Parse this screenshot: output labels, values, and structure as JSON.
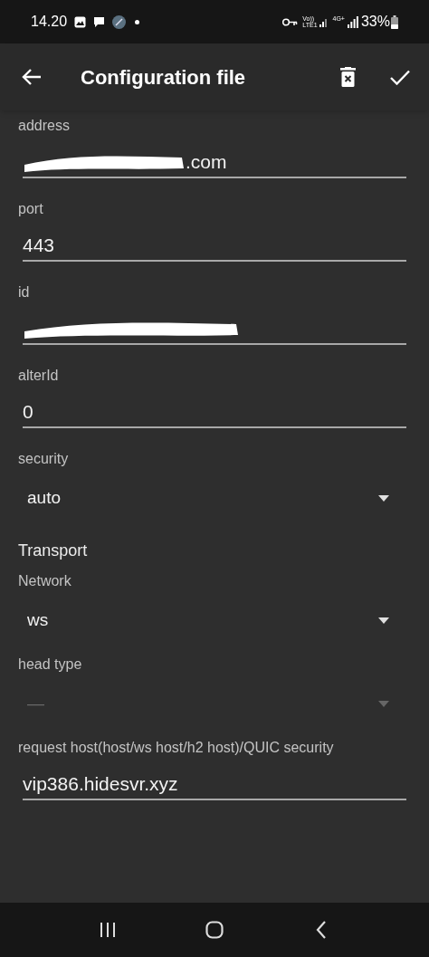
{
  "status_bar": {
    "time": "14.20",
    "volte": "Vo))",
    "lte": "LTE1",
    "network": "4G+",
    "battery": "33%"
  },
  "app_bar": {
    "title": "Configuration file"
  },
  "fields": [
    {
      "kind": "text",
      "label": "address",
      "value": ".com",
      "redacted": true
    },
    {
      "kind": "text",
      "label": "port",
      "value": "443",
      "redacted": false
    },
    {
      "kind": "text",
      "label": "id",
      "redacted": true
    },
    {
      "kind": "text",
      "label": "alterId",
      "value": "0",
      "redacted": false
    },
    {
      "kind": "select",
      "label": "security",
      "value": "auto",
      "disabled": false
    },
    {
      "kind": "section",
      "label": "Transport"
    },
    {
      "kind": "select",
      "label": "Network",
      "value": "ws",
      "disabled": false
    },
    {
      "kind": "select",
      "label": "head type",
      "value": "—",
      "disabled": true
    },
    {
      "kind": "text",
      "label": "request host(host/ws host/h2 host)/QUIC security",
      "value": "vip386.hidesvr.xyz",
      "redacted": false
    }
  ]
}
